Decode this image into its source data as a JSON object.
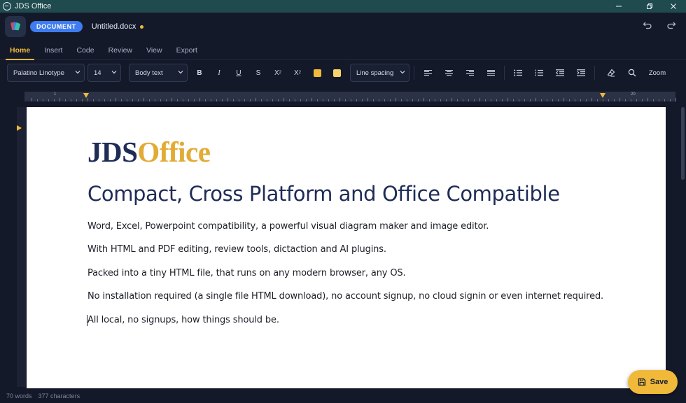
{
  "window": {
    "title": "JDS Office",
    "minimize_icon": "minimize-icon",
    "maximize_icon": "restore-icon",
    "close_icon": "close-icon"
  },
  "header": {
    "mode_badge": "DOCUMENT",
    "document_name": "Untitled.docx",
    "unsaved_color": "#f0b93a",
    "undo_icon": "undo-icon",
    "redo_icon": "redo-icon"
  },
  "tabs": [
    {
      "label": "Home",
      "active": true
    },
    {
      "label": "Insert",
      "active": false
    },
    {
      "label": "Code",
      "active": false
    },
    {
      "label": "Review",
      "active": false
    },
    {
      "label": "View",
      "active": false
    },
    {
      "label": "Export",
      "active": false
    }
  ],
  "toolbar": {
    "font_family": "Palatino Linotype",
    "font_size": "14",
    "paragraph_style": "Body text",
    "bold": "B",
    "italic": "I",
    "underline": "U",
    "strike": "S",
    "subscript": "X",
    "subscript_mark": "2",
    "superscript": "X",
    "superscript_mark": "2",
    "highlight_color": "#f0b93a",
    "text_color": "#f7d36b",
    "line_spacing": "Line spacing",
    "zoom": "Zoom"
  },
  "ruler": {
    "labels": [
      "1",
      "20"
    ]
  },
  "document": {
    "brand_part1": "JDS",
    "brand_part2": "Office",
    "heading": "Compact, Cross Platform and Office Compatible",
    "paragraphs": [
      "Word, Excel, Powerpoint compatibility, a powerful visual diagram maker and image editor.",
      "With HTML and PDF editing, review tools, dictaction and AI plugins.",
      "Packed into a tiny HTML file, that runs on any modern browser, any OS.",
      "No installation required (a single file HTML download), no account signup, no cloud signin or even internet required.",
      "All local, no signups, how things should be."
    ]
  },
  "status": {
    "words": "70 words",
    "characters": "377 characters"
  },
  "save_button": {
    "label": "Save",
    "icon": "save-icon"
  }
}
